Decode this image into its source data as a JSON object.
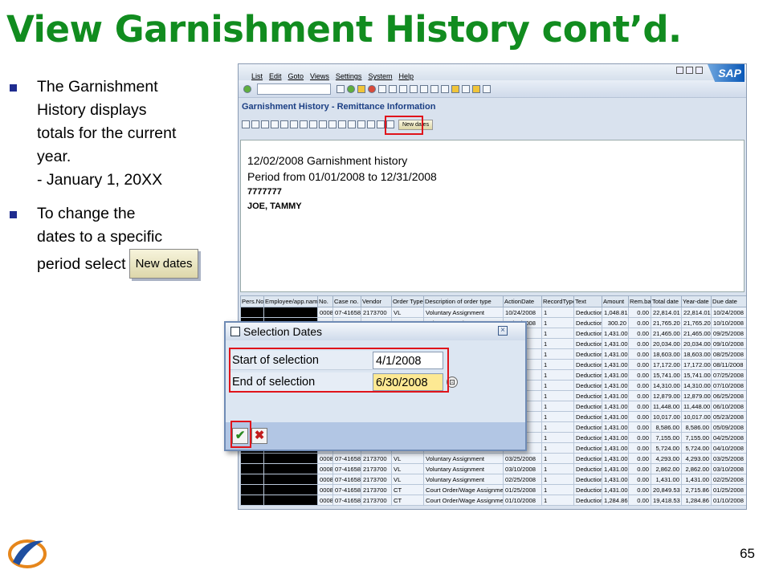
{
  "slide": {
    "title": "View Garnishment History cont’d.",
    "page_number": "65",
    "bullets": [
      {
        "lines": [
          "The Garnishment",
          "History displays",
          "totals for the current",
          "year.",
          "- January 1, 20XX"
        ]
      },
      {
        "lines": [
          "To change the",
          "dates to a specific"
        ],
        "last_line": "period select",
        "button_label": "New dates"
      }
    ]
  },
  "sap": {
    "menu": [
      "List",
      "Edit",
      "Goto",
      "Views",
      "Settings",
      "System",
      "Help"
    ],
    "logo_text": "SAP",
    "screen_title": "Garnishment History - Remittance Information",
    "new_dates_label": "New dates",
    "report": {
      "heading": "12/02/2008 Garnishment history",
      "period": "Period from 01/01/2008 to 12/31/2008",
      "pers_no": "7777777",
      "name": "JOE, TAMMY"
    },
    "table": {
      "headers": [
        "Pers.No.",
        "Employee/app.name",
        "No.",
        "Case no.",
        "Vendor",
        "Order Type",
        "Description of order type",
        "ActionDate",
        "RecordType",
        "Text",
        "Amount",
        "Rem.bal.",
        "Total date",
        "Year-date",
        "Due date"
      ],
      "rows": [
        [
          "",
          "",
          "0008",
          "07-41658",
          "2173700",
          "VL",
          "Voluntary Assignment",
          "10/24/2008",
          "1",
          "Deduction",
          "1,048.81",
          "0.00",
          "22,814.01",
          "22,814.01",
          "10/24/2008"
        ],
        [
          "",
          "",
          "0008",
          "07-41658",
          "2173700",
          "VL",
          "Voluntary Assignment",
          "10/10/2008",
          "1",
          "Deduction",
          "300.20",
          "0.00",
          "21,765.20",
          "21,765.20",
          "10/10/2008"
        ],
        [
          "",
          "",
          "",
          "",
          "",
          "",
          "",
          "",
          "1",
          "Deduction",
          "1,431.00",
          "0.00",
          "21,465.00",
          "21,465.00",
          "09/25/2008"
        ],
        [
          "",
          "",
          "",
          "",
          "",
          "",
          "",
          "",
          "1",
          "Deduction",
          "1,431.00",
          "0.00",
          "20,034.00",
          "20,034.00",
          "09/10/2008"
        ],
        [
          "",
          "",
          "",
          "",
          "",
          "",
          "",
          "",
          "1",
          "Deduction",
          "1,431.00",
          "0.00",
          "18,603.00",
          "18,603.00",
          "08/25/2008"
        ],
        [
          "",
          "",
          "",
          "",
          "",
          "",
          "",
          "",
          "1",
          "Deduction",
          "1,431.00",
          "0.00",
          "17,172.00",
          "17,172.00",
          "08/11/2008"
        ],
        [
          "",
          "",
          "",
          "",
          "",
          "",
          "",
          "",
          "1",
          "Deduction",
          "1,431.00",
          "0.00",
          "15,741.00",
          "15,741.00",
          "07/25/2008"
        ],
        [
          "",
          "",
          "",
          "",
          "",
          "",
          "",
          "",
          "1",
          "Deduction",
          "1,431.00",
          "0.00",
          "14,310.00",
          "14,310.00",
          "07/10/2008"
        ],
        [
          "",
          "",
          "",
          "",
          "",
          "",
          "",
          "",
          "1",
          "Deduction",
          "1,431.00",
          "0.00",
          "12,879.00",
          "12,879.00",
          "06/25/2008"
        ],
        [
          "",
          "",
          "",
          "",
          "",
          "",
          "",
          "",
          "1",
          "Deduction",
          "1,431.00",
          "0.00",
          "11,448.00",
          "11,448.00",
          "06/10/2008"
        ],
        [
          "",
          "",
          "",
          "",
          "",
          "",
          "",
          "",
          "1",
          "Deduction",
          "1,431.00",
          "0.00",
          "10,017.00",
          "10,017.00",
          "05/23/2008"
        ],
        [
          "",
          "",
          "",
          "",
          "",
          "",
          "",
          "",
          "1",
          "Deduction",
          "1,431.00",
          "0.00",
          "8,586.00",
          "8,586.00",
          "05/09/2008"
        ],
        [
          "",
          "",
          "",
          "",
          "",
          "",
          "",
          "",
          "1",
          "Deduction",
          "1,431.00",
          "0.00",
          "7,155.00",
          "7,155.00",
          "04/25/2008"
        ],
        [
          "",
          "",
          "",
          "",
          "",
          "",
          "",
          "",
          "1",
          "Deduction",
          "1,431.00",
          "0.00",
          "5,724.00",
          "5,724.00",
          "04/10/2008"
        ],
        [
          "",
          "",
          "0008",
          "07-41658",
          "2173700",
          "VL",
          "Voluntary Assignment",
          "03/25/2008",
          "1",
          "Deduction",
          "1,431.00",
          "0.00",
          "4,293.00",
          "4,293.00",
          "03/25/2008"
        ],
        [
          "",
          "",
          "0008",
          "07-41658",
          "2173700",
          "VL",
          "Voluntary Assignment",
          "03/10/2008",
          "1",
          "Deduction",
          "1,431.00",
          "0.00",
          "2,862.00",
          "2,862.00",
          "03/10/2008"
        ],
        [
          "",
          "",
          "0008",
          "07-41658",
          "2173700",
          "VL",
          "Voluntary Assignment",
          "02/25/2008",
          "1",
          "Deduction",
          "1,431.00",
          "0.00",
          "1,431.00",
          "1,431.00",
          "02/25/2008"
        ],
        [
          "",
          "",
          "0008",
          "07-41658",
          "2173700",
          "CT",
          "Court Order/Wage Assignment",
          "01/25/2008",
          "1",
          "Deduction",
          "1,431.00",
          "0.00",
          "20,849.53",
          "2,715.86",
          "01/25/2008"
        ],
        [
          "",
          "",
          "0008",
          "07-41658",
          "2173700",
          "CT",
          "Court Order/Wage Assignment",
          "01/10/2008",
          "1",
          "Deduction",
          "1,284.86",
          "0.00",
          "19,418.53",
          "1,284.86",
          "01/10/2008"
        ]
      ]
    },
    "dialog": {
      "title": "Selection Dates",
      "start_label": "Start of selection",
      "start_value": "4/1/2008",
      "end_label": "End of selection",
      "end_value": "6/30/2008",
      "ok_icon": "checkmark-icon",
      "cancel_icon": "x-icon"
    }
  },
  "colors": {
    "title_green": "#118c1f",
    "bullet_blue": "#1f2c8f",
    "highlight_red": "#e0141b",
    "input_yellow": "#fde993"
  }
}
